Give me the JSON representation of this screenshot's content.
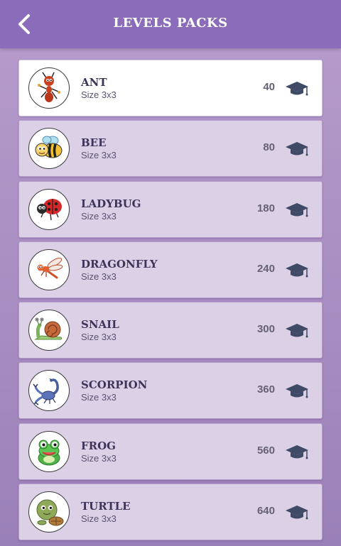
{
  "header": {
    "title": "LEVELS PACKS"
  },
  "packs": [
    {
      "name": "ANT",
      "size": "Size 3x3",
      "points": "40",
      "icon": "ant-icon"
    },
    {
      "name": "BEE",
      "size": "Size 3x3",
      "points": "80",
      "icon": "bee-icon"
    },
    {
      "name": "LADYBUG",
      "size": "Size 3x3",
      "points": "180",
      "icon": "ladybug-icon"
    },
    {
      "name": "DRAGONFLY",
      "size": "Size 3x3",
      "points": "240",
      "icon": "dragonfly-icon"
    },
    {
      "name": "SNAIL",
      "size": "Size 3x3",
      "points": "300",
      "icon": "snail-icon"
    },
    {
      "name": "SCORPION",
      "size": "Size 3x3",
      "points": "360",
      "icon": "scorpion-icon"
    },
    {
      "name": "FROG",
      "size": "Size 3x3",
      "points": "560",
      "icon": "frog-icon"
    },
    {
      "name": "TURTLE",
      "size": "Size 3x3",
      "points": "640",
      "icon": "turtle-icon"
    }
  ],
  "colors": {
    "header": "#8a6cba",
    "card": "#dcd0e7",
    "card_selected": "#ffffff",
    "text_dark": "#3d3458",
    "cap": "#3e4a66"
  }
}
